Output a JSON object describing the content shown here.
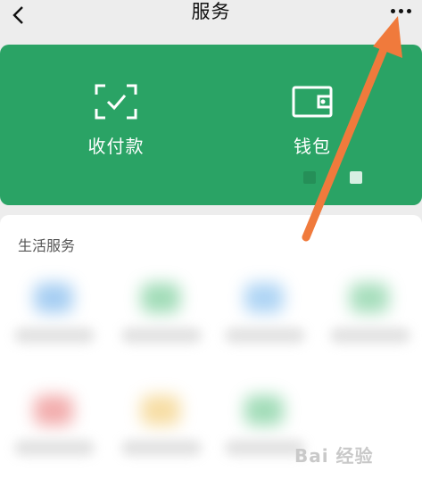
{
  "nav": {
    "title": "服务"
  },
  "wallet_panel": {
    "items": [
      {
        "label": "收付款"
      },
      {
        "label": "钱包"
      }
    ],
    "accent_color": "#2aa365"
  },
  "life_services": {
    "heading": "生活服务"
  },
  "colors": {
    "arrow": "#f07a3c",
    "background": "#ededed"
  }
}
